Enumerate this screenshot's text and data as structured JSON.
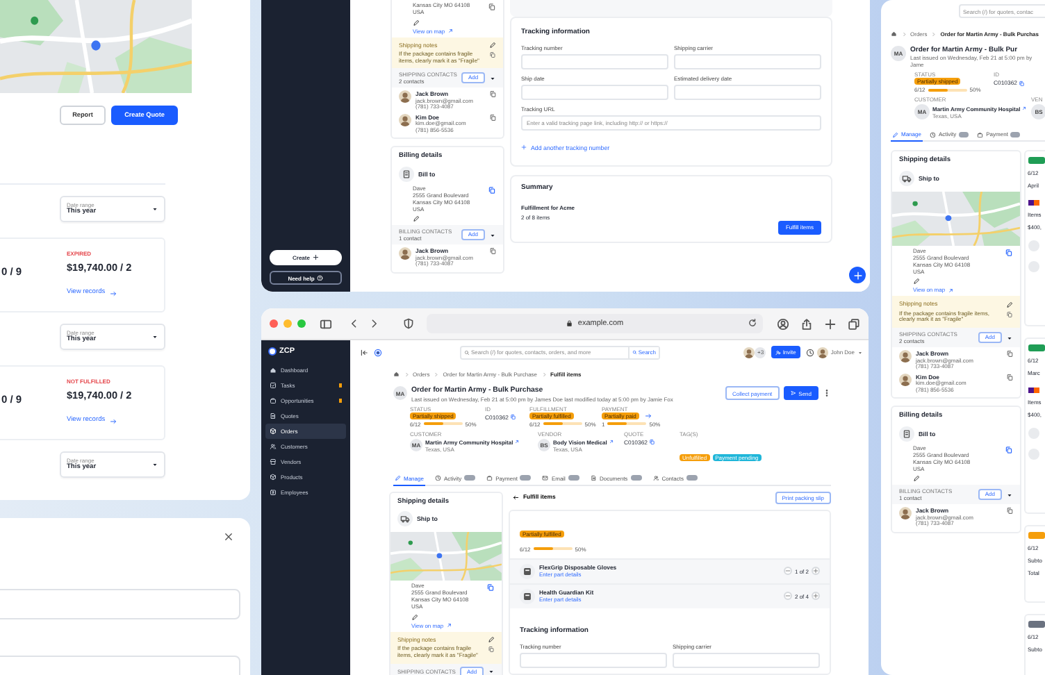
{
  "quote_panel": {
    "map": {
      "kind": "picture"
    },
    "actions": [
      {
        "label": "Report",
        "kind": "secondary"
      },
      {
        "label": "Create Quote",
        "kind": "primary"
      }
    ],
    "rows": [
      {
        "kind": "date_range",
        "label": "Date range",
        "value": "This year"
      },
      {
        "kind": "summary",
        "total": "0 / 9",
        "status": "EXPIRED",
        "amount": "$19,740.00 / 2",
        "link": "View records"
      },
      {
        "kind": "date_range",
        "label": "Date range",
        "value": "This year"
      },
      {
        "kind": "summary",
        "total": "0 / 9",
        "status": "NOT FULFILLED",
        "amount": "$19,740.00 / 2",
        "link": "View records"
      },
      {
        "kind": "date_range",
        "label": "Date range",
        "value": "This year"
      }
    ]
  },
  "dialog_panel": {
    "fields": [
      {
        "kind": "text"
      },
      {
        "kind": "text"
      }
    ]
  },
  "order_panel": {
    "sidebar_buttons": [
      {
        "label": "Create",
        "kind": "primary"
      },
      {
        "label": "Need help",
        "kind": "outline"
      }
    ],
    "shipping": {
      "address": [
        "Kansas City MO 64108",
        "USA"
      ],
      "view_on_map": "View on map",
      "notes": {
        "title": "Shipping notes",
        "text": "If the package contains fragile items, clearly mark it as \"Fragile\""
      },
      "contacts": {
        "title": "SHIPPING CONTACTS",
        "count": "2 contacts",
        "add": "Add",
        "people": [
          {
            "name": "Jack Brown",
            "email": "jack.brown@gmail.com",
            "phone": "(781) 733-4087"
          },
          {
            "name": "Kim Doe",
            "email": "kim.doe@gmail.com",
            "phone": "(781) 856-5536"
          }
        ]
      }
    },
    "billing": {
      "title": "Billing details",
      "bill_to": "Bill to",
      "address": [
        "Dave",
        "2555 Grand Boulevard",
        "Kansas City MO 64108",
        "USA"
      ],
      "contacts": {
        "title": "BILLING CONTACTS",
        "count": "1 contact",
        "add": "Add",
        "people": [
          {
            "name": "Jack Brown",
            "email": "jack.brown@gmail.com",
            "phone": "(781) 733-4087"
          }
        ]
      }
    },
    "tracking": {
      "title": "Tracking information",
      "fields": [
        {
          "label": "Tracking number",
          "wide": false
        },
        {
          "label": "Shipping carrier",
          "wide": false
        },
        {
          "label": "Ship date",
          "wide": false
        },
        {
          "label": "Estimated delivery date",
          "wide": false
        },
        {
          "label": "Tracking URL",
          "placeholder": "Enter a valid tracking page link, including http:// or https://",
          "wide": true
        }
      ],
      "add_link": "Add another tracking number"
    },
    "summary": {
      "title": "Summary",
      "subtitle": "Fulfillment for Acme",
      "count": "2 of 8 items",
      "button": "Fulfill items"
    }
  },
  "browser": {
    "url": "example.com",
    "app": {
      "logo": "ZCP",
      "nav": [
        {
          "label": "Dashboard",
          "selected": false,
          "dot": false
        },
        {
          "label": "Tasks",
          "selected": false,
          "dot": true
        },
        {
          "label": "Opportunities",
          "selected": false,
          "dot": true
        },
        {
          "label": "Quotes",
          "selected": false,
          "dot": false
        },
        {
          "label": "Orders",
          "selected": true,
          "dot": false
        },
        {
          "label": "Customers",
          "selected": false,
          "dot": false
        },
        {
          "label": "Vendors",
          "selected": false,
          "dot": false
        },
        {
          "label": "Products",
          "selected": false,
          "dot": false
        },
        {
          "label": "Employees",
          "selected": false,
          "dot": false
        }
      ],
      "search": {
        "placeholder": "Search (/) for quotes, contacts, orders, and more",
        "button": "Search"
      },
      "team_extra": "+3",
      "invite": "Invite",
      "user": "John Doe",
      "breadcrumb": [
        "Orders",
        "Order for Martin Army - Bulk Purchase",
        "Fulfill items"
      ],
      "header": {
        "initials": "MA",
        "title": "Order for Martin Army - Bulk Purchase",
        "subtitle": "Last issued on Wednesday, Feb 21 at 5:00 pm by James Doe last modified today at 5:00 pm by Jamie Fox",
        "actions": [
          {
            "label": "Collect payment",
            "kind": "outline"
          },
          {
            "label": "Send",
            "kind": "primary"
          }
        ]
      },
      "facts": [
        [
          {
            "kind": "progress",
            "label": "STATUS",
            "badge": "Partially shipped",
            "count": "6/12",
            "level": 0.5,
            "percent": "50%"
          },
          {
            "kind": "id",
            "label": "ID",
            "value": "C010362"
          },
          {
            "kind": "progress",
            "label": "FULFILLMENT",
            "badge": "Partially fulfilled",
            "count": "6/12",
            "level": 0.5,
            "percent": "50%"
          },
          {
            "kind": "progress",
            "label": "PAYMENT",
            "badge": "Partially paid",
            "count": "1",
            "level": 0.5,
            "percent": "50%"
          }
        ],
        [
          {
            "kind": "entity",
            "label": "CUSTOMER",
            "initials": "MA",
            "name": "Martin Army Community Hospital",
            "sub": "Texas, USA"
          },
          {
            "kind": "entity",
            "label": "VENDOR",
            "initials": "BS",
            "name": "Body Vision Medical",
            "sub": "Texas, USA"
          },
          {
            "kind": "id",
            "label": "QUOTE",
            "value": "C010362"
          },
          {
            "kind": "tags",
            "label": "TAG(S)",
            "tags": [
              {
                "label": "Unfulfilled",
                "color": "#f59e0b"
              },
              {
                "label": "Payment pending",
                "color": "#1fb6d9"
              }
            ]
          }
        ]
      ],
      "tabs": [
        {
          "label": "Manage",
          "selected": true,
          "badge": false
        },
        {
          "label": "Activity",
          "selected": false,
          "badge": true
        },
        {
          "label": "Payment",
          "selected": false,
          "badge": true
        },
        {
          "label": "Email",
          "selected": false,
          "badge": true
        },
        {
          "label": "Documents",
          "selected": false,
          "badge": true
        },
        {
          "label": "Contacts",
          "selected": false,
          "badge": true
        }
      ],
      "shipping": {
        "title": "Shipping details",
        "ship_to": "Ship to",
        "map": {
          "kind": "picture"
        },
        "address": [
          "Dave",
          "2555 Grand Boulevard",
          "Kansas City MO 64108",
          "USA"
        ],
        "view_on_map": "View on map",
        "notes": {
          "title": "Shipping notes",
          "text": "If the package contains fragile items, clearly mark it as \"Fragile\""
        },
        "contacts": {
          "title": "SHIPPING CONTACTS",
          "add": "Add"
        }
      },
      "fulfill": {
        "back": "Fulfill items",
        "print": "Print packing slip",
        "badge": "Partially fulfilled",
        "count": "6/12",
        "level": 0.5,
        "percent": "50%",
        "items": [
          {
            "name": "FlexGrip Disposable Gloves",
            "link": "Enter part details",
            "qty": "1 of 2"
          },
          {
            "name": "Health Guardian Kit",
            "link": "Enter part details",
            "qty": "2 of 4"
          }
        ],
        "tracking": {
          "title": "Tracking information",
          "fields": [
            {
              "label": "Tracking number",
              "wide": false
            },
            {
              "label": "Shipping carrier",
              "wide": false
            }
          ]
        }
      }
    }
  },
  "side_panel": {
    "search": {
      "placeholder": "Search (/) for quotes, contac"
    },
    "breadcrumb": [
      "Orders",
      "Order for Martin Army - Bulk Purchas"
    ],
    "header": {
      "initials": "MA",
      "title": "Order for Martin Army - Bulk Pur",
      "subtitle": "Last issued on Wednesday, Feb 21 at 5:00 pm by Jame"
    },
    "facts": [
      [
        {
          "kind": "progress",
          "label": "STATUS",
          "badge": "Partially shipped",
          "count": "6/12",
          "level": 0.5,
          "percent": "50%"
        },
        {
          "kind": "id",
          "label": "ID",
          "value": "C010362"
        }
      ],
      [
        {
          "kind": "entity",
          "label": "CUSTOMER",
          "initials": "MA",
          "name": "Martin Army Community Hospital",
          "sub": "Texas, USA"
        },
        {
          "kind": "cut",
          "label": "VEN",
          "initials": "BS"
        }
      ]
    ],
    "tabs": [
      {
        "label": "Manage",
        "selected": true,
        "badge": false
      },
      {
        "label": "Activity",
        "selected": false,
        "badge": true
      },
      {
        "label": "Payment",
        "selected": false,
        "badge": true
      }
    ],
    "shipping": {
      "title": "Shipping details",
      "ship_to": "Ship to",
      "map": {
        "kind": "picture"
      },
      "address": [
        "Dave",
        "2555 Grand Boulevard",
        "Kansas City MO 64108",
        "USA"
      ],
      "view_on_map": "View on map",
      "notes": {
        "title": "Shipping notes",
        "text": "If the package contains fragile items, clearly mark it as \"Fragile\""
      },
      "contacts": {
        "title": "SHIPPING CONTACTS",
        "count": "2 contacts",
        "add": "Add",
        "people": [
          {
            "name": "Jack Brown",
            "email": "jack.brown@gmail.com",
            "phone": "(781) 733-4087"
          },
          {
            "name": "Kim Doe",
            "email": "kim.doe@gmail.com",
            "phone": "(781) 856-5536"
          }
        ]
      }
    },
    "billing": {
      "title": "Billing details",
      "bill_to": "Bill to",
      "address": [
        "Dave",
        "2555 Grand Boulevard",
        "Kansas City MO 64108",
        "USA"
      ],
      "contacts": {
        "title": "BILLING CONTACTS",
        "count": "1 contact",
        "add": "Add",
        "people": [
          {
            "name": "Jack Brown",
            "email": "jack.brown@gmail.com",
            "phone": "(781) 733-4087"
          }
        ]
      }
    },
    "peek": [
      {
        "color": "#1f9d55",
        "lines": [
          {
            "kind": "text",
            "text": "6/12"
          },
          {
            "kind": "text",
            "text": "April"
          },
          {
            "kind": "logo"
          },
          {
            "kind": "text",
            "text": "Items"
          },
          {
            "kind": "text",
            "text": "$400,"
          },
          {
            "kind": "icon"
          },
          {
            "kind": "icon"
          }
        ]
      },
      {
        "color": "#1f9d55",
        "lines": [
          {
            "kind": "text",
            "text": "6/12"
          },
          {
            "kind": "text",
            "text": "Marc"
          },
          {
            "kind": "logo"
          },
          {
            "kind": "text",
            "text": "Items"
          },
          {
            "kind": "text",
            "text": "$400,"
          },
          {
            "kind": "icon"
          },
          {
            "kind": "icon"
          }
        ]
      },
      {
        "color": "#f59e0b",
        "lines": [
          {
            "kind": "text",
            "text": "6/12"
          },
          {
            "kind": "text",
            "text": "Subto"
          },
          {
            "kind": "text",
            "text": "Total"
          }
        ]
      },
      {
        "color": "#6b7280",
        "lines": [
          {
            "kind": "text",
            "text": "6/12"
          },
          {
            "kind": "text",
            "text": "Subto"
          }
        ]
      }
    ]
  }
}
